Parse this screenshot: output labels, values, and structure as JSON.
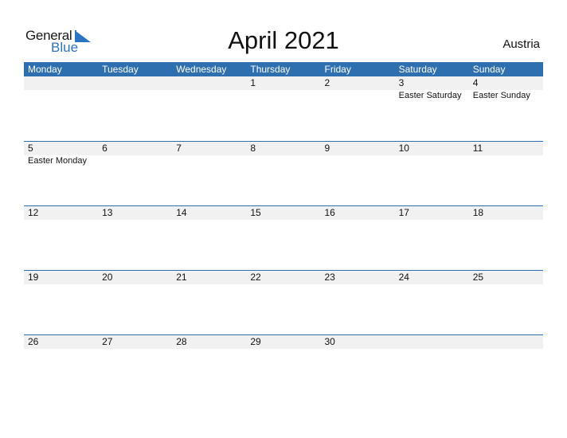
{
  "logo": {
    "word1": "General",
    "word2": "Blue"
  },
  "header": {
    "title": "April 2021",
    "country": "Austria"
  },
  "weekdays": [
    "Monday",
    "Tuesday",
    "Wednesday",
    "Thursday",
    "Friday",
    "Saturday",
    "Sunday"
  ],
  "weeks": [
    [
      {
        "day": "",
        "event": ""
      },
      {
        "day": "",
        "event": ""
      },
      {
        "day": "",
        "event": ""
      },
      {
        "day": "1",
        "event": ""
      },
      {
        "day": "2",
        "event": ""
      },
      {
        "day": "3",
        "event": "Easter Saturday"
      },
      {
        "day": "4",
        "event": "Easter Sunday"
      }
    ],
    [
      {
        "day": "5",
        "event": "Easter Monday"
      },
      {
        "day": "6",
        "event": ""
      },
      {
        "day": "7",
        "event": ""
      },
      {
        "day": "8",
        "event": ""
      },
      {
        "day": "9",
        "event": ""
      },
      {
        "day": "10",
        "event": ""
      },
      {
        "day": "11",
        "event": ""
      }
    ],
    [
      {
        "day": "12",
        "event": ""
      },
      {
        "day": "13",
        "event": ""
      },
      {
        "day": "14",
        "event": ""
      },
      {
        "day": "15",
        "event": ""
      },
      {
        "day": "16",
        "event": ""
      },
      {
        "day": "17",
        "event": ""
      },
      {
        "day": "18",
        "event": ""
      }
    ],
    [
      {
        "day": "19",
        "event": ""
      },
      {
        "day": "20",
        "event": ""
      },
      {
        "day": "21",
        "event": ""
      },
      {
        "day": "22",
        "event": ""
      },
      {
        "day": "23",
        "event": ""
      },
      {
        "day": "24",
        "event": ""
      },
      {
        "day": "25",
        "event": ""
      }
    ],
    [
      {
        "day": "26",
        "event": ""
      },
      {
        "day": "27",
        "event": ""
      },
      {
        "day": "28",
        "event": ""
      },
      {
        "day": "29",
        "event": ""
      },
      {
        "day": "30",
        "event": ""
      },
      {
        "day": "",
        "event": ""
      },
      {
        "day": "",
        "event": ""
      }
    ]
  ],
  "colors": {
    "accent": "#2e6fb0",
    "strip": "#f1f1f1",
    "logo_blue": "#2a74c4"
  }
}
